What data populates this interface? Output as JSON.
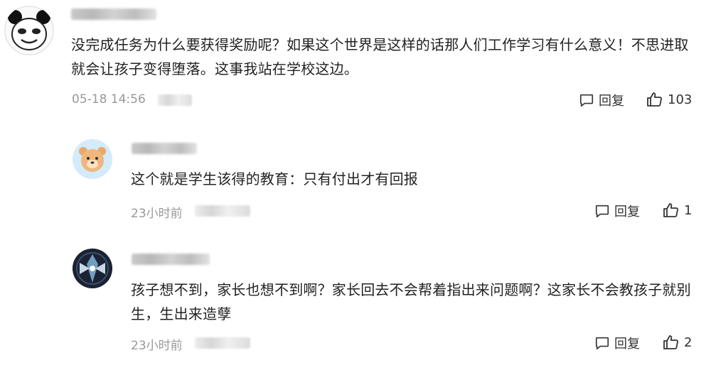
{
  "comments": [
    {
      "text": "没完成任务为什么要获得奖励呢？如果这个世界是这样的话那人们工作学习有什么意义！不思进取就会让孩子变得堕落。这事我站在学校这边。",
      "time": "05-18 14:56",
      "reply_label": "回复",
      "likes": "103",
      "avatar_icon": "panda-meme-avatar"
    },
    {
      "text": "这个就是学生该得的教育：只有付出才有回报",
      "time": "23小时前",
      "reply_label": "回复",
      "likes": "1",
      "avatar_icon": "bear-avatar"
    },
    {
      "text": "孩子想不到，家长也想不到啊？家长回去不会帮着指出来问题啊？这家长不会教孩子就别生，生出来造孽",
      "time": "23小时前",
      "reply_label": "回复",
      "likes": "2",
      "avatar_icon": "dark-emblem-avatar"
    }
  ],
  "colors": {
    "text": "#222222",
    "meta": "#999999",
    "icon": "#333333"
  },
  "icons": {
    "reply": "comment-bubble-icon",
    "like": "thumbs-up-icon"
  }
}
